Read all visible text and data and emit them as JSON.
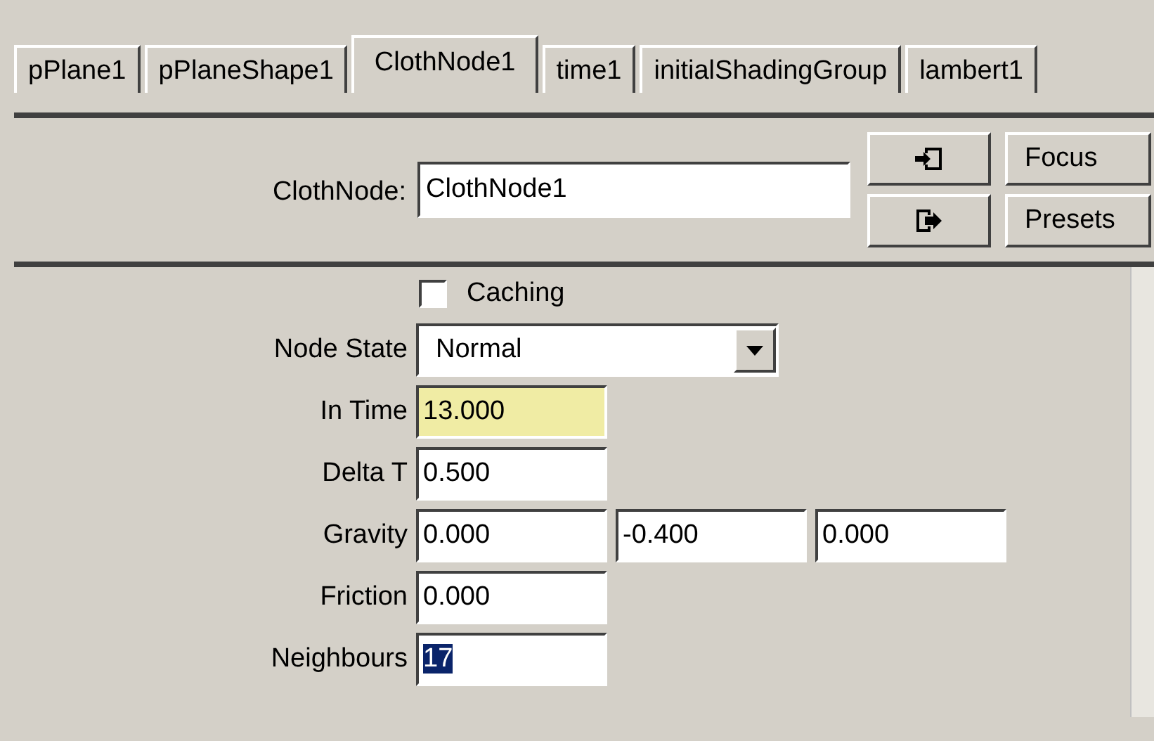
{
  "tabs": [
    {
      "label": "pPlane1",
      "selected": false
    },
    {
      "label": "pPlaneShape1",
      "selected": false
    },
    {
      "label": "ClothNode1",
      "selected": true
    },
    {
      "label": "time1",
      "selected": false
    },
    {
      "label": "initialShadingGroup",
      "selected": false
    },
    {
      "label": "lambert1",
      "selected": false
    }
  ],
  "header": {
    "label": "ClothNode:",
    "value": "ClothNode1",
    "buttons": [
      "Focus",
      "Presets"
    ]
  },
  "attributes": [
    {
      "kind": "checkbox",
      "label": "Caching",
      "checked": false
    },
    {
      "kind": "dropdown",
      "label": "Node State",
      "value": "Normal"
    },
    {
      "kind": "fields",
      "label": "In Time",
      "fields": [
        {
          "value": "13.000",
          "keyed": true,
          "text_selected": false
        }
      ]
    },
    {
      "kind": "fields",
      "label": "Delta T",
      "fields": [
        {
          "value": "0.500",
          "keyed": false,
          "text_selected": false
        }
      ]
    },
    {
      "kind": "fields",
      "label": "Gravity",
      "fields": [
        {
          "value": "0.000",
          "keyed": false,
          "text_selected": false
        },
        {
          "value": "-0.400",
          "keyed": false,
          "text_selected": false
        },
        {
          "value": "0.000",
          "keyed": false,
          "text_selected": false
        }
      ]
    },
    {
      "kind": "fields",
      "label": "Friction",
      "fields": [
        {
          "value": "0.000",
          "keyed": false,
          "text_selected": false
        }
      ]
    },
    {
      "kind": "fields",
      "label": "Neighbours",
      "fields": [
        {
          "value": "17",
          "keyed": false,
          "text_selected": true
        }
      ]
    }
  ]
}
